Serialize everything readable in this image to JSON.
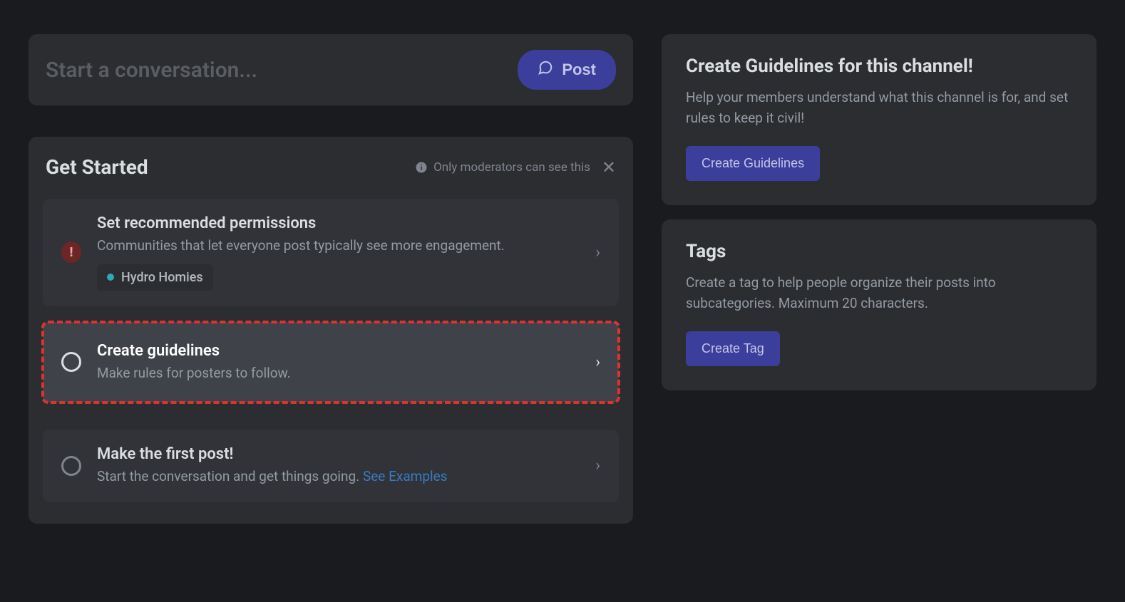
{
  "compose": {
    "placeholder": "Start a conversation...",
    "post_label": "Post"
  },
  "get_started": {
    "title": "Get Started",
    "note": "Only moderators can see this",
    "tasks": [
      {
        "title": "Set recommended permissions",
        "desc": "Communities that let everyone post typically see more engagement.",
        "tag": "Hydro Homies"
      },
      {
        "title": "Create guidelines",
        "desc": "Make rules for posters to follow."
      },
      {
        "title": "Make the first post!",
        "desc": "Start the conversation and get things going. ",
        "link_text": "See Examples"
      }
    ]
  },
  "guidelines": {
    "title": "Create Guidelines for this channel!",
    "desc": "Help your members understand what this channel is for, and set rules to keep it civil!",
    "button": "Create Guidelines"
  },
  "tags": {
    "title": "Tags",
    "desc": "Create a tag to help people organize their posts into subcategories. Maximum 20 characters.",
    "button": "Create Tag"
  }
}
